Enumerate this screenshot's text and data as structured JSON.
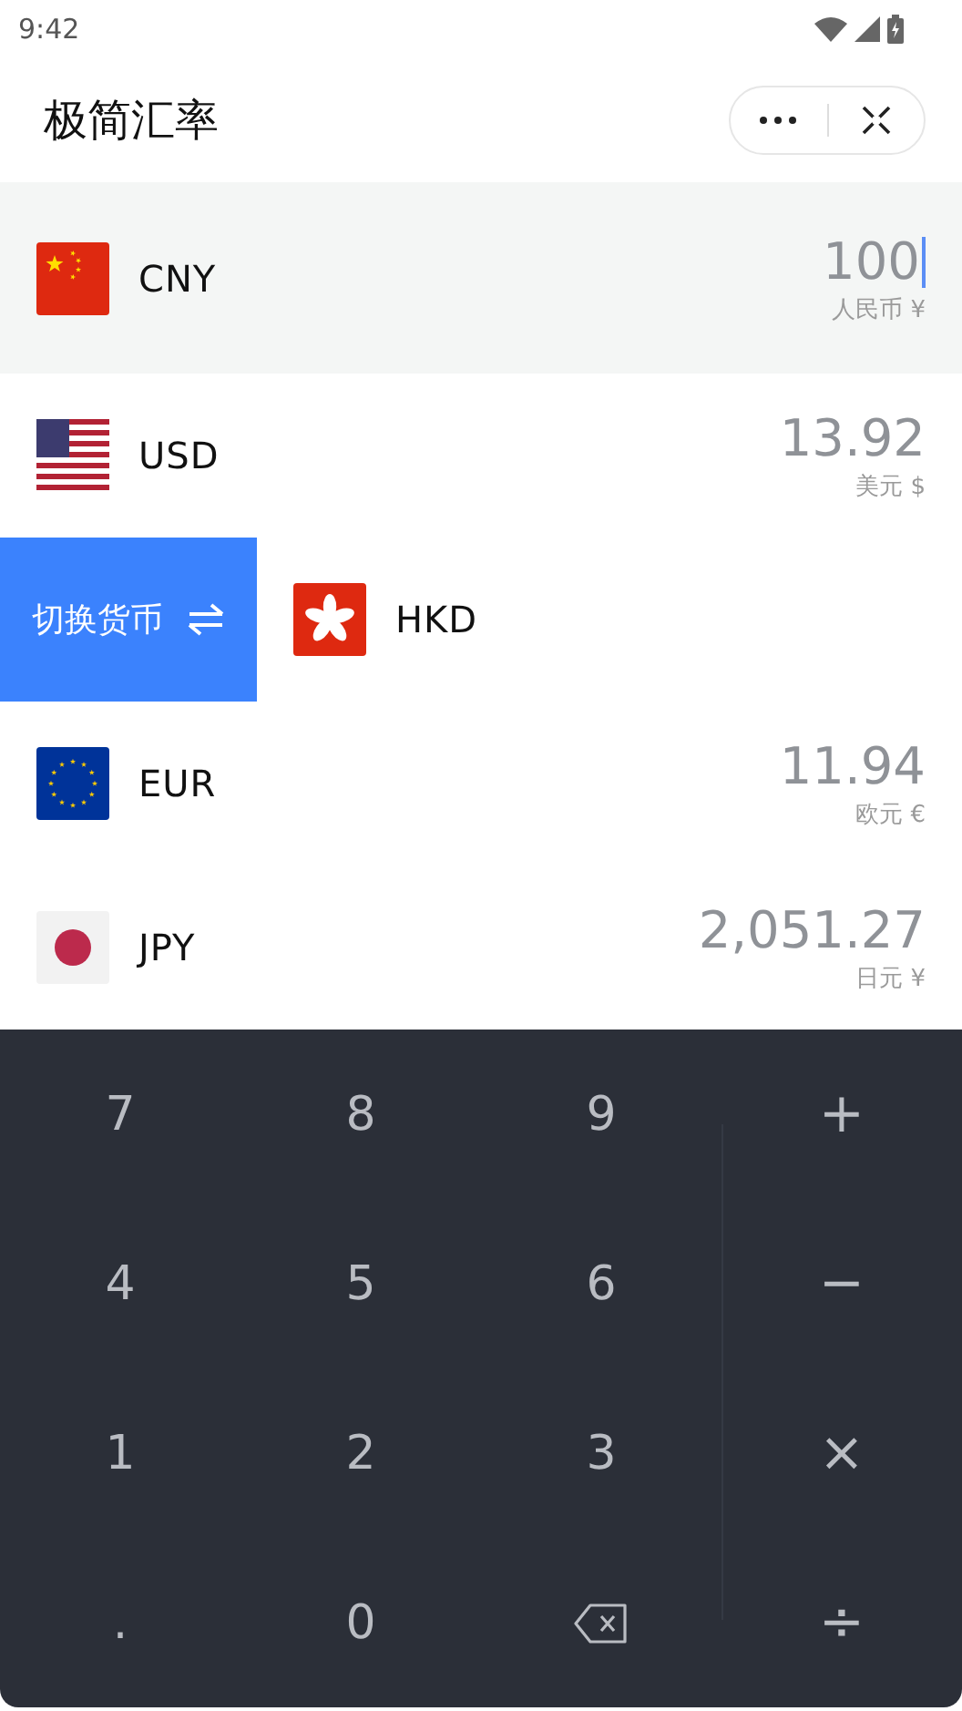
{
  "status_bar": {
    "time": "9:42"
  },
  "header": {
    "title": "极简汇率"
  },
  "rows": [
    {
      "kind": "cn",
      "code": "CNY",
      "amount": "100",
      "name": "人民币 ¥",
      "selected": true,
      "swiped": false
    },
    {
      "kind": "us",
      "code": "USD",
      "amount": "13.92",
      "name": "美元 $",
      "selected": false,
      "swiped": false
    },
    {
      "kind": "hk",
      "code": "HKD",
      "selected": false,
      "swiped": true,
      "action": "切换货币"
    },
    {
      "kind": "eu",
      "code": "EUR",
      "amount": "11.94",
      "name": "欧元 €",
      "selected": false,
      "swiped": false
    },
    {
      "kind": "jp",
      "code": "JPY",
      "amount": "2,051.27",
      "name": "日元 ¥",
      "selected": false,
      "swiped": false
    }
  ],
  "keypad": [
    {
      "kind": "digit",
      "label": "7"
    },
    {
      "kind": "digit",
      "label": "8"
    },
    {
      "kind": "digit",
      "label": "9"
    },
    {
      "kind": "op",
      "label": "+"
    },
    {
      "kind": "digit",
      "label": "4"
    },
    {
      "kind": "digit",
      "label": "5"
    },
    {
      "kind": "digit",
      "label": "6"
    },
    {
      "kind": "op",
      "label": "−"
    },
    {
      "kind": "digit",
      "label": "1"
    },
    {
      "kind": "digit",
      "label": "2"
    },
    {
      "kind": "digit",
      "label": "3"
    },
    {
      "kind": "op",
      "label": "×"
    },
    {
      "kind": "digit",
      "label": "."
    },
    {
      "kind": "digit",
      "label": "0"
    },
    {
      "kind": "backspace"
    },
    {
      "kind": "op",
      "label": "÷"
    }
  ]
}
